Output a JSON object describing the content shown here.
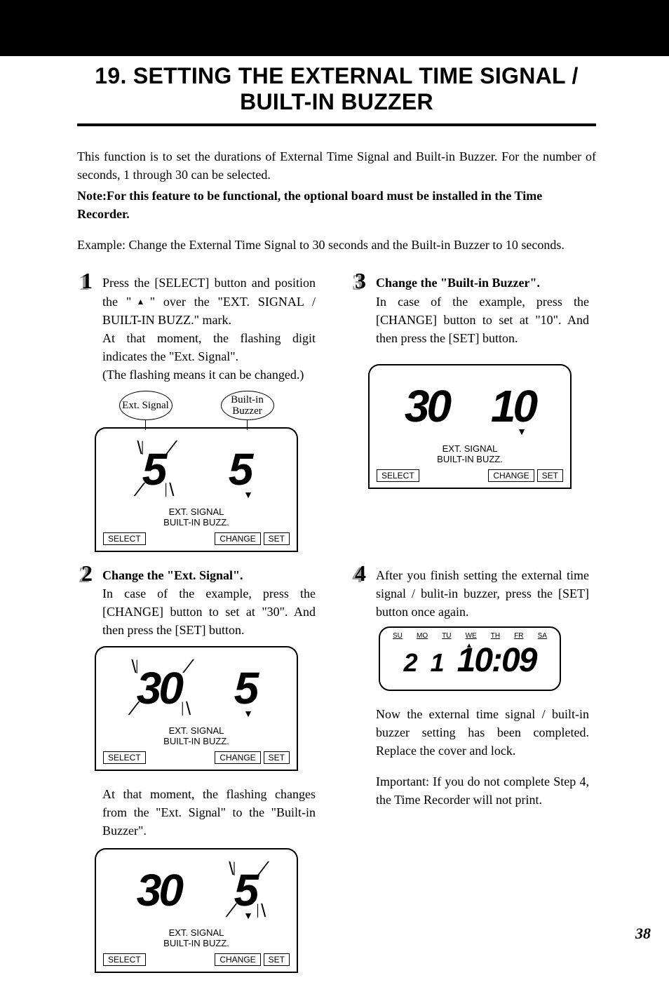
{
  "header": {
    "title": "19. SETTING THE EXTERNAL TIME SIGNAL / BUILT-IN BUZZER"
  },
  "intro": "This function is to set the durations of External Time Signal and Built-in Buzzer. For the number of seconds, 1 through 30 can be selected.",
  "note": "Note:For this feature to be functional, the optional board must be installed in the Time Recorder.",
  "example": "Example: Change the External Time Signal to 30 seconds and the Built-in Buzzer to 10 seconds.",
  "steps": {
    "s1": {
      "num": "1",
      "body_a": "Press the [SELECT] button and position the \"",
      "body_b": "\" over the \"EXT. SIGNAL / BUILT-IN BUZZ.\" mark.",
      "body_c": "At that moment, the flashing digit indicates the \"Ext. Signal\".",
      "body_d": "(The flashing means it can be changed.)"
    },
    "s2": {
      "num": "2",
      "head": "Change the \"Ext. Signal\".",
      "body": "In case of the example, press the [CHANGE] button to set at \"30\". And then press the [SET] button.",
      "after": "At that moment, the flashing changes from the \"Ext. Signal\" to the \"Built-in Buzzer\"."
    },
    "s3": {
      "num": "3",
      "head": "Change the \"Built-in Buzzer\".",
      "body": "In case of the example, press the [CHANGE] button to set at \"10\". And then press the [SET] button."
    },
    "s4": {
      "num": "4",
      "body": "After you finish setting the external time signal / bulit-in buzzer, press the [SET] button once again.",
      "after_a": "Now the external time signal / built-in buzzer setting has been completed. Replace the cover and lock.",
      "after_b": "Important: If you do not complete Step 4, the Time Recorder will  not print."
    }
  },
  "callouts": {
    "ext": "Ext. Signal",
    "builtin": "Built-in Buzzer"
  },
  "lcd": {
    "mode1": "EXT. SIGNAL",
    "mode2": "BUILT-IN BUZZ.",
    "select": "SELECT",
    "change": "CHANGE",
    "set": "SET",
    "d1": {
      "left": "5",
      "right": "5"
    },
    "d2": {
      "left": "30",
      "right": "5"
    },
    "d3": {
      "left": "30",
      "right": "5"
    },
    "d4": {
      "left": "30",
      "right": "10"
    }
  },
  "clock": {
    "days": {
      "su": "SU",
      "mo": "MO",
      "tu": "TU",
      "we": "WE",
      "th": "TH",
      "fr": "FR",
      "sa": "SA"
    },
    "date": "2 1",
    "time": "10:09"
  },
  "page_number": "38"
}
